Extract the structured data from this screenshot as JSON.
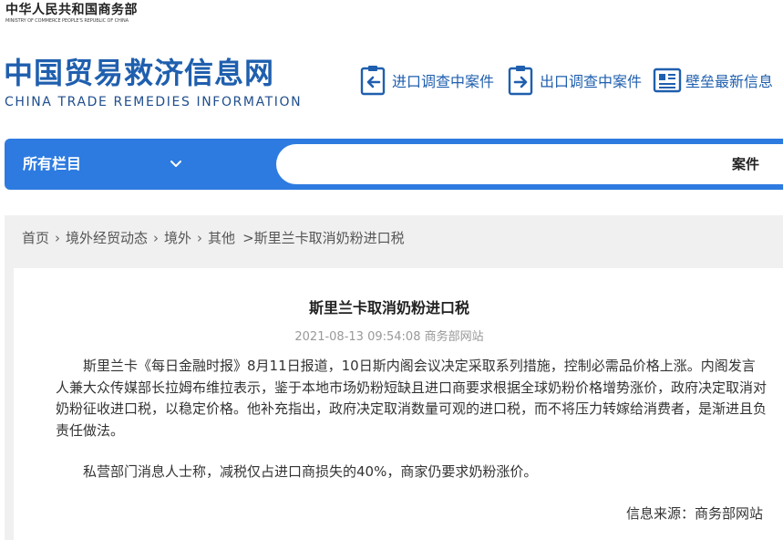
{
  "ministry": {
    "name_cn": "中华人民共和国商务部",
    "name_en": "MINISTRY OF COMMERCE PEOPLE'S REPUBLIC OF CHINA"
  },
  "site": {
    "logo_cn": "中国贸易救济信息网",
    "logo_en": "CHINA TRADE REMEDIES INFORMATION"
  },
  "top_links": [
    {
      "label": "进口调查中案件",
      "icon": "import-case-icon"
    },
    {
      "label": "出口调查中案件",
      "icon": "export-case-icon"
    },
    {
      "label": "壁垒最新信息",
      "icon": "barrier-news-icon"
    }
  ],
  "nav": {
    "all_columns_label": "所有栏目",
    "search_button_label": "案件"
  },
  "breadcrumb": {
    "home": "首页",
    "level1": "境外经贸动态",
    "level2": "境外",
    "level3": "其他",
    "current": ">斯里兰卡取消奶粉进口税"
  },
  "article": {
    "title": "斯里兰卡取消奶粉进口税",
    "meta": "2021-08-13 09:54:08 商务部网站",
    "paragraphs": [
      "斯里兰卡《每日金融时报》8月11日报道，10日斯内阁会议决定采取系列措施，控制必需品价格上涨。内阁发言人兼大众传媒部长拉姆布维拉表示，鉴于本地市场奶粉短缺且进口商要求根据全球奶粉价格增势涨价，政府决定取消对奶粉征收进口税，以稳定价格。他补充指出，政府决定取消数量可观的进口税，而不将压力转嫁给消费者，是渐进且负责任做法。",
      "私营部门消息人士称，减税仅占进口商损失的40%，商家仍要求奶粉涨价。"
    ],
    "source": "信息来源：商务部网站"
  },
  "colors": {
    "brand_blue": "#1f5fae",
    "nav_blue": "#2d7be0",
    "content_bg": "#f0f0f0"
  }
}
